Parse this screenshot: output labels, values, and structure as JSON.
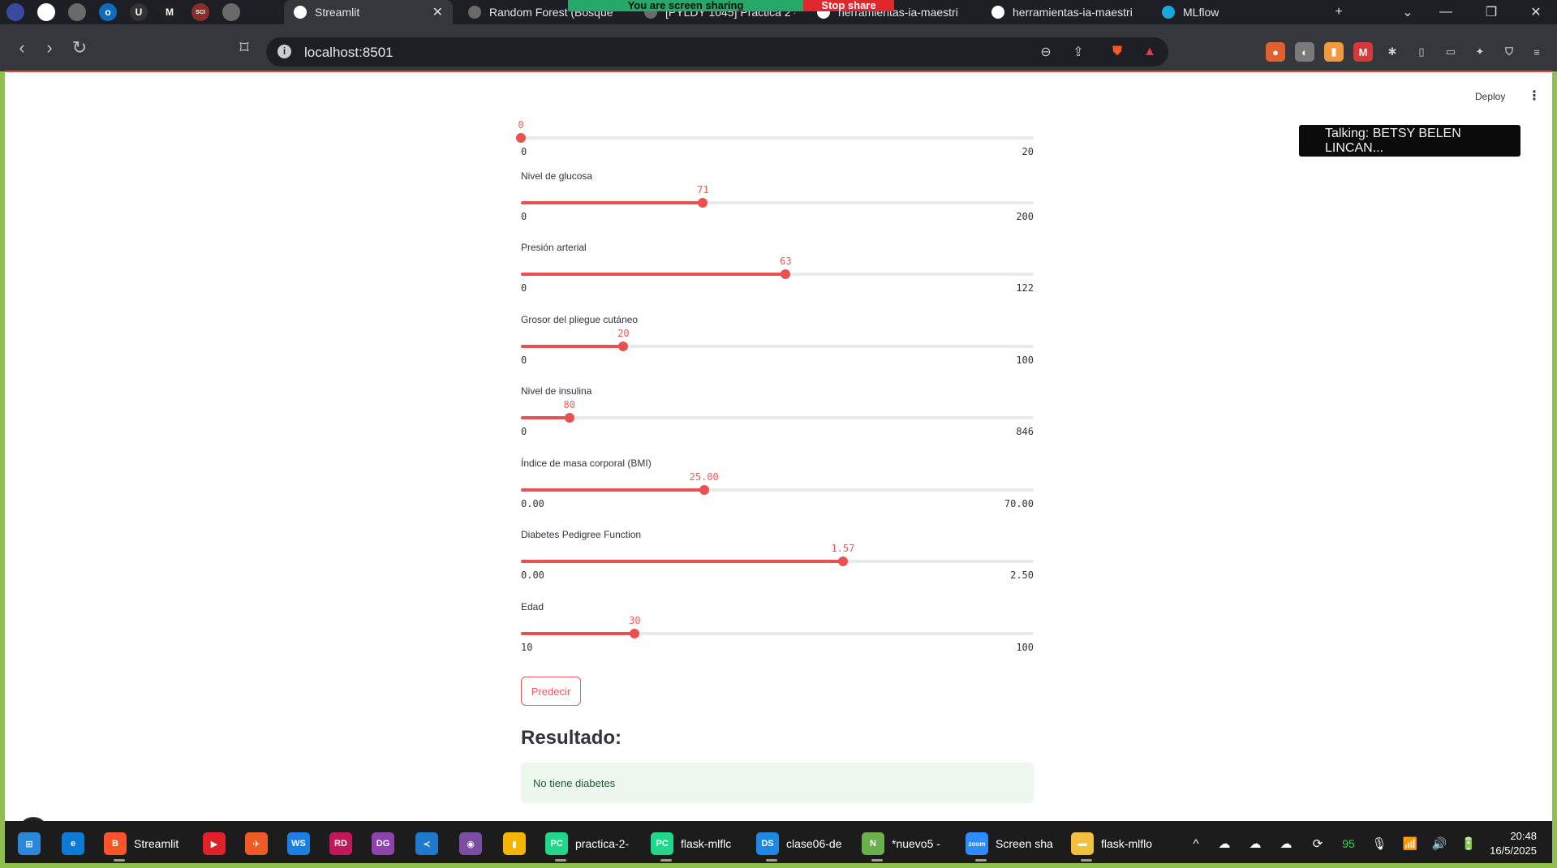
{
  "browser": {
    "pinned_tabs": [
      {
        "icon": "app-icon",
        "glyph": "",
        "color": "#3a4aa0"
      },
      {
        "icon": "circle-app-icon",
        "glyph": "",
        "color": "#ffffff"
      },
      {
        "icon": "globe-icon",
        "glyph": "",
        "color": "#6a6a6a"
      },
      {
        "icon": "outlook-icon",
        "glyph": "o",
        "color": "#0f6cbd"
      },
      {
        "icon": "u-app-icon",
        "glyph": "U",
        "color": "#333333"
      },
      {
        "icon": "m-app-icon",
        "glyph": "M",
        "color": "#222222"
      },
      {
        "icon": "scihub-icon",
        "glyph": "SCI",
        "color": "#8a2d2d"
      },
      {
        "icon": "globe-icon",
        "glyph": "",
        "color": "#6a6a6a"
      }
    ],
    "tabs": [
      {
        "label": "Streamlit",
        "active": true
      },
      {
        "label": "Random Forest (Bosque"
      },
      {
        "label": "[PYLDY 1045] Práctica 2 -"
      },
      {
        "label": "herramientas-ia-maestri"
      },
      {
        "label": "herramientas-ia-maestri"
      },
      {
        "label": "MLflow"
      }
    ],
    "tab_close": "✕",
    "new_tab": "+",
    "screen_share_text": "You are screen sharing",
    "stop_share_text": "Stop share",
    "address": "localhost:8501",
    "window_controls": [
      "⌄",
      "—",
      "❐",
      "✕"
    ]
  },
  "app": {
    "deploy_label": "Deploy",
    "menu_glyph": "⋮",
    "toast_text": "Talking: BETSY BELEN LINCAN...",
    "sliders": [
      {
        "label": "",
        "value": 0,
        "display": "0",
        "min": 0,
        "max": 20,
        "min_label": "0",
        "max_label": "20"
      },
      {
        "label": "Nivel de glucosa",
        "value": 71,
        "display": "71",
        "min": 0,
        "max": 200,
        "min_label": "0",
        "max_label": "200"
      },
      {
        "label": "Presión arterial",
        "value": 63,
        "display": "63",
        "min": 0,
        "max": 122,
        "min_label": "0",
        "max_label": "122"
      },
      {
        "label": "Grosor del pliegue cutáneo",
        "value": 20,
        "display": "20",
        "min": 0,
        "max": 100,
        "min_label": "0",
        "max_label": "100"
      },
      {
        "label": "Nivel de insulina",
        "value": 80,
        "display": "80",
        "min": 0,
        "max": 846,
        "min_label": "0",
        "max_label": "846"
      },
      {
        "label": "Índice de masa corporal (BMI)",
        "value": 25.0,
        "display": "25.00",
        "min": 0,
        "max": 70,
        "min_label": "0.00",
        "max_label": "70.00"
      },
      {
        "label": "Diabetes Pedigree Function",
        "value": 1.57,
        "display": "1.57",
        "min": 0,
        "max": 2.5,
        "min_label": "0.00",
        "max_label": "2.50"
      },
      {
        "label": "Edad",
        "value": 30,
        "display": "30",
        "min": 10,
        "max": 100,
        "min_label": "10",
        "max_label": "100"
      }
    ],
    "predict_label": "Predecir",
    "result_title": "Resultado:",
    "result_text": "No tiene diabetes"
  },
  "taskbar": {
    "items": [
      {
        "name": "windows-start-icon",
        "glyph": "⊞",
        "color": "#2b88d8",
        "label": ""
      },
      {
        "name": "edge-icon",
        "glyph": "e",
        "color": "#0c7bd6",
        "label": ""
      },
      {
        "name": "brave-icon",
        "glyph": "B",
        "color": "#fb542b",
        "label": "Streamlit"
      },
      {
        "name": "youtube-music-icon",
        "glyph": "▶",
        "color": "#e2202a",
        "label": ""
      },
      {
        "name": "postman-icon",
        "glyph": "✈",
        "color": "#ef5b25",
        "label": ""
      },
      {
        "name": "webstorm-icon",
        "glyph": "WS",
        "color": "#1c7ee1",
        "label": ""
      },
      {
        "name": "rider-icon",
        "glyph": "RD",
        "color": "#c2185b",
        "label": ""
      },
      {
        "name": "datagrip-icon",
        "glyph": "DG",
        "color": "#8e44ad",
        "label": ""
      },
      {
        "name": "vscode-icon",
        "glyph": "≺",
        "color": "#1f7acc",
        "label": ""
      },
      {
        "name": "github-desktop-icon",
        "glyph": "◉",
        "color": "#7b4ea2",
        "label": ""
      },
      {
        "name": "notes-icon",
        "glyph": "▮",
        "color": "#f4b400",
        "label": ""
      },
      {
        "name": "pycharm-icon",
        "glyph": "PC",
        "color": "#21d789",
        "label": "practica-2-"
      },
      {
        "name": "pycharm-icon",
        "glyph": "PC",
        "color": "#21d789",
        "label": "flask-mlflc"
      },
      {
        "name": "dataspell-icon",
        "glyph": "DS",
        "color": "#1e88e5",
        "label": "clase06-de"
      },
      {
        "name": "notepad-plus-icon",
        "glyph": "N",
        "color": "#6ab04c",
        "label": "*nuevo5 -"
      },
      {
        "name": "zoom-icon",
        "glyph": "zoom",
        "color": "#2d8cff",
        "label": "Screen sha"
      },
      {
        "name": "folder-icon",
        "glyph": "▬",
        "color": "#f3c03e",
        "label": "flask-mlflo"
      }
    ],
    "tray": [
      "^",
      "☁",
      "☁",
      "☁",
      "⟳",
      "95",
      "🎙",
      "📶",
      "🔊",
      "🔋"
    ],
    "time": "20:48",
    "date": "16/5/2025"
  }
}
